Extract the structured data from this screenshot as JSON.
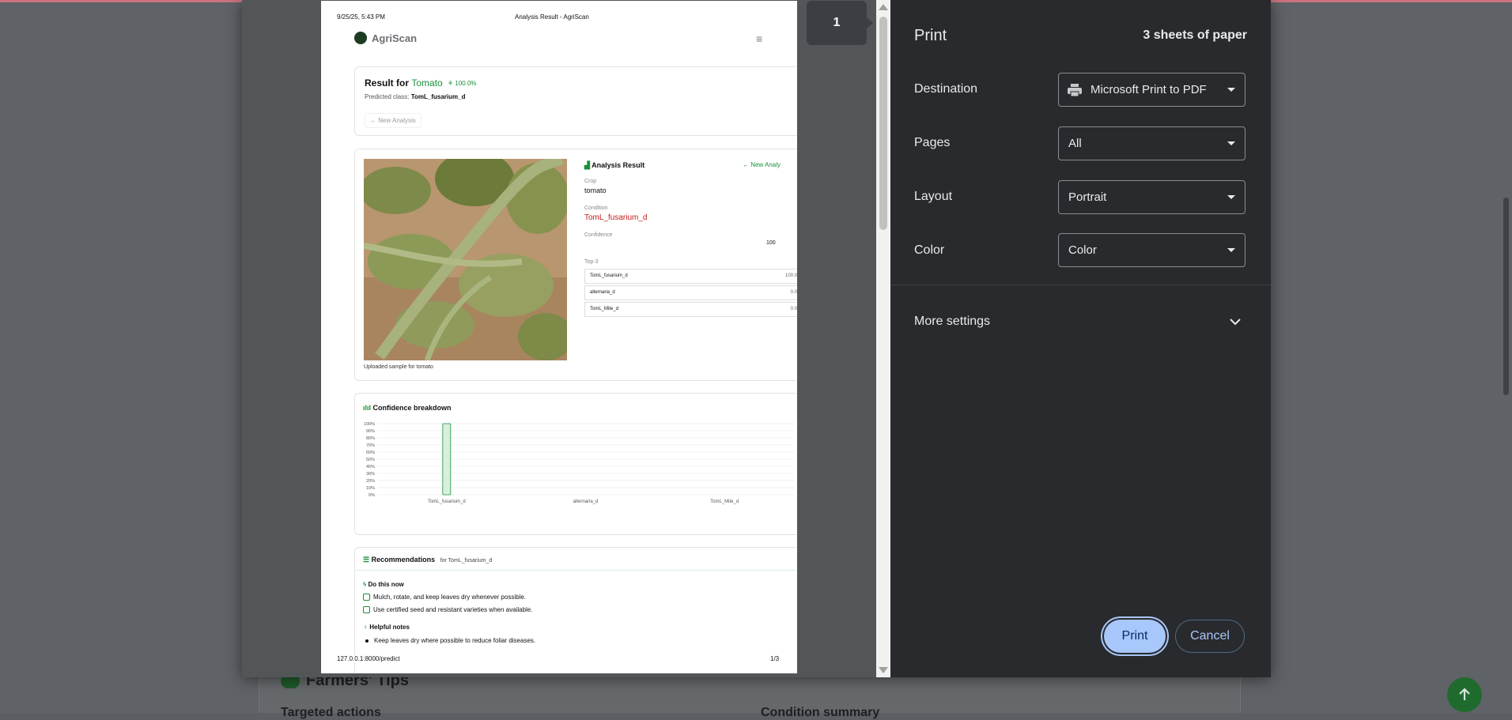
{
  "background": {
    "tips_title": "Farmers' Tips",
    "col1_heading": "Targeted actions",
    "col2_heading": "Condition summary"
  },
  "preview": {
    "page_indicator": "1",
    "header_datetime": "9/25/25, 5:43 PM",
    "header_title": "Analysis Result - AgriScan",
    "footer_url": "127.0.0.1:8000/predict",
    "footer_page": "1/3",
    "brand": "AgriScan",
    "result": {
      "title_prefix": "Result for",
      "crop": "Tomato",
      "confidence": "100.0%",
      "predicted_label": "Predicted class:",
      "predicted_value": "TomL_fusarium_d",
      "new_analysis": "New Analysis"
    },
    "analysis": {
      "title": "Analysis Result",
      "new_analysis": "New Analy",
      "crop_label": "Crop",
      "crop_value": "tomato",
      "condition_label": "Condition",
      "condition_value": "TomL_fusarium_d",
      "confidence_label": "Confidence",
      "confidence_value": "100",
      "top3_label": "Top-3",
      "top3": [
        {
          "name": "TomL_fusarium_d",
          "pct": "100.0"
        },
        {
          "name": "alternaria_d",
          "pct": "0.0"
        },
        {
          "name": "TomL_Mite_d",
          "pct": "0.0"
        }
      ],
      "image_caption": "Uploaded sample for tomato"
    },
    "recommendations": {
      "title": "Recommendations",
      "for_text": "for TomL_fusarium_d",
      "do_now_heading": "Do this now",
      "do_now_items": [
        "Mulch, rotate, and keep leaves dry whenever possible.",
        "Use certified seed and resistant varieties when available."
      ],
      "notes_heading": "Helpful notes",
      "notes_items": [
        "Keep leaves dry where possible to reduce foliar diseases."
      ]
    }
  },
  "chart_data": {
    "type": "bar",
    "title": "Confidence breakdown",
    "categories": [
      "TomL_fusarium_d",
      "alternaria_d",
      "TomL_Mite_d"
    ],
    "values": [
      100,
      0,
      0
    ],
    "ylim": [
      0,
      100
    ],
    "y_ticks": [
      "0%",
      "10%",
      "20%",
      "30%",
      "40%",
      "50%",
      "60%",
      "70%",
      "80%",
      "90%",
      "100%"
    ],
    "grid": true,
    "bar_color": "#1a8f3a"
  },
  "print_panel": {
    "title": "Print",
    "sheets": "3 sheets of paper",
    "destination_label": "Destination",
    "destination_value": "Microsoft Print to PDF",
    "pages_label": "Pages",
    "pages_value": "All",
    "layout_label": "Layout",
    "layout_value": "Portrait",
    "color_label": "Color",
    "color_value": "Color",
    "more_settings": "More settings",
    "print_button": "Print",
    "cancel_button": "Cancel"
  },
  "colors": {
    "panel_bg": "#292a2d",
    "accent": "#a8c7fa",
    "brand_green": "#1a8f3a",
    "condition_red": "#c41b1b"
  }
}
